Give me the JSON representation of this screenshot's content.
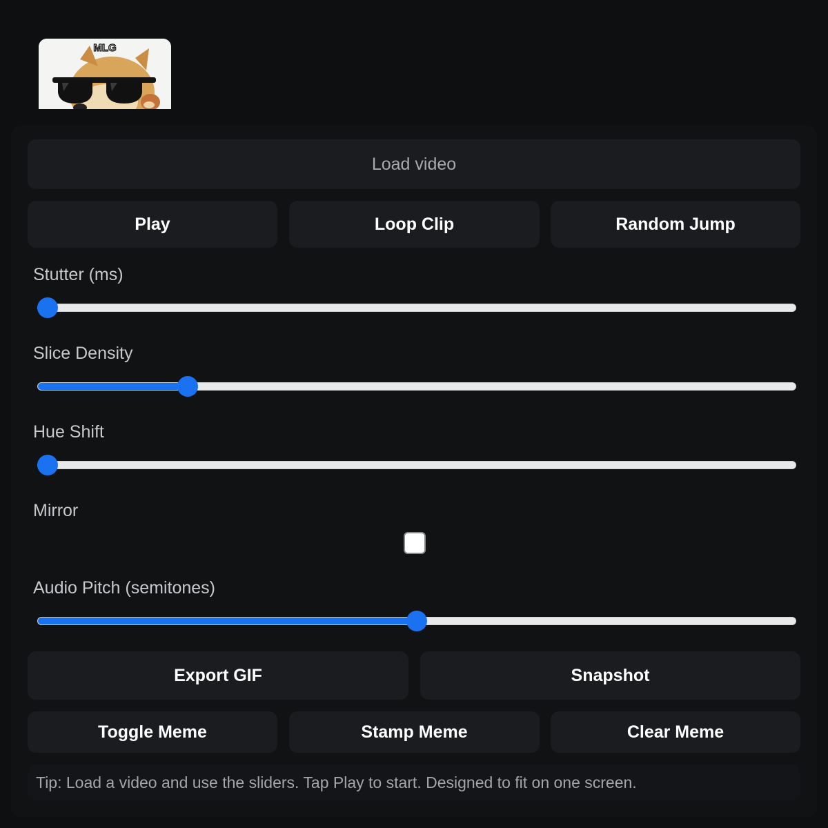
{
  "meme_image": {
    "caption": "MLG"
  },
  "load_button": {
    "label": "Load video"
  },
  "transport": {
    "play_label": "Play",
    "loop_label": "Loop Clip",
    "random_label": "Random Jump"
  },
  "controls": {
    "stutter": {
      "label": "Stutter (ms)",
      "value_fraction": 0.0
    },
    "slice_density": {
      "label": "Slice Density",
      "value_fraction": 0.19
    },
    "hue_shift": {
      "label": "Hue Shift",
      "value_fraction": 0.0
    },
    "mirror": {
      "label": "Mirror",
      "checked": false
    },
    "audio_pitch": {
      "label": "Audio Pitch (semitones)",
      "value_fraction": 0.5
    }
  },
  "actions": {
    "export_gif_label": "Export GIF",
    "snapshot_label": "Snapshot",
    "toggle_meme_label": "Toggle Meme",
    "stamp_meme_label": "Stamp Meme",
    "clear_meme_label": "Clear Meme"
  },
  "tip": {
    "text": "Tip: Load a video and use the sliders. Tap Play to start. Designed to fit on one screen."
  },
  "colors": {
    "accent": "#1a72f0",
    "background": "#0d0f11",
    "button": "#1a1c1f"
  }
}
